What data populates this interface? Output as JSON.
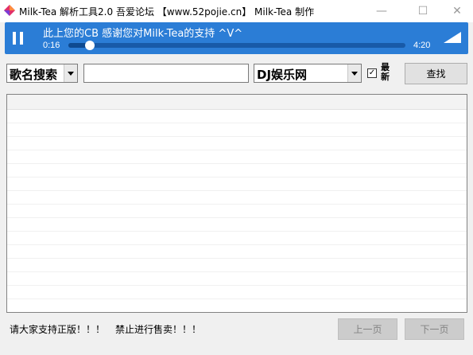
{
  "window": {
    "title": "Milk-Tea 解析工具2.0    吾爱论坛 【www.52pojie.cn】 Milk-Tea 制作",
    "controls": {
      "minimize": "—",
      "maximize": "☐",
      "close": "✕"
    }
  },
  "player": {
    "now_playing": "此上您的CB 感谢您对Milk-Tea的支持 ^V^",
    "current_time": "0:16",
    "total_time": "4:20",
    "progress": 0.063,
    "icons": {
      "play_state": "pause-icon",
      "volume": "volume-icon"
    },
    "accent_color": "#2b7dd6"
  },
  "toolbar": {
    "search_type": "歌名搜索",
    "search_query": "",
    "source": "DJ娱乐网",
    "latest_checked": true,
    "latest_label": "最新",
    "find_label": "查找"
  },
  "results": {
    "rows": []
  },
  "footer": {
    "notice_left": "请大家支持正版！！！",
    "notice_right": "禁止进行售卖！！！",
    "prev_label": "上一页",
    "next_label": "下一页"
  }
}
